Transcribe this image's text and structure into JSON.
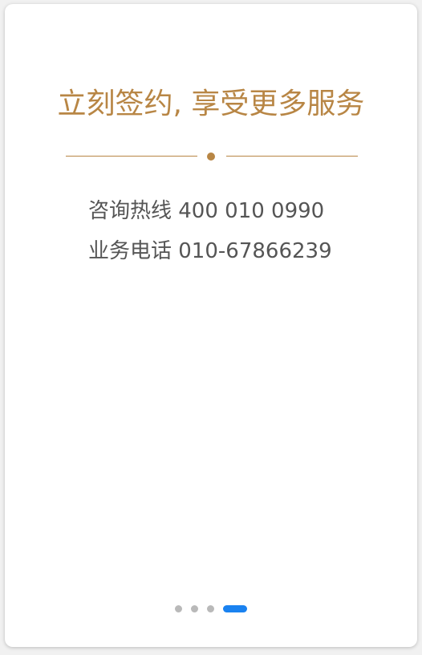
{
  "card": {
    "title": "立刻签约, 享受更多服务",
    "contacts": {
      "hotline": "咨询热线 400 010 0990",
      "phone": "业务电话 010-67866239"
    }
  },
  "pager": {
    "total_pages": 4,
    "active_page": 4
  },
  "colors": {
    "accent_gold": "#b88645",
    "active_indicator": "#1a82f0",
    "inactive_indicator": "#b9b9b9",
    "body_text": "#555555"
  }
}
